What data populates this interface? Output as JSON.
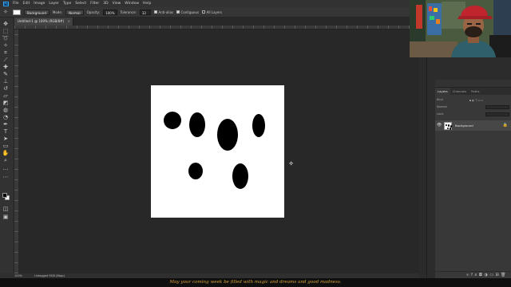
{
  "menubar": {
    "logo": "Ps",
    "items": [
      "File",
      "Edit",
      "Image",
      "Layer",
      "Type",
      "Select",
      "Filter",
      "3D",
      "View",
      "Window",
      "Help"
    ]
  },
  "optionsbar": {
    "sample_value": "Background",
    "mode_label": "Mode:",
    "mode_value": "Normal",
    "opacity_label": "Opacity:",
    "opacity_value": "100%",
    "tolerance_label": "Tolerance:",
    "tolerance_value": "32",
    "antialias_label": "Anti-alias",
    "antialias_checked": true,
    "contiguous_label": "Contiguous",
    "contiguous_checked": true,
    "alllayers_label": "All Layers",
    "alllayers_checked": false
  },
  "document": {
    "tab_title": "Untitled-1 @ 100% (RGB/8#)"
  },
  "statusbar": {
    "zoom": "100%",
    "info": "Untagged RGB (8bpc)"
  },
  "layers_panel": {
    "tabs": [
      "Layers",
      "Channels",
      "Paths"
    ],
    "active_tab": "Layers",
    "kind_label": "Kind",
    "blend_mode": "Normal",
    "lock_label": "Lock:",
    "layers": [
      {
        "name": "Background",
        "visible": true,
        "locked": true
      }
    ]
  },
  "subtitle": {
    "text": "May your coming week be filled with magic and dreams and good madness."
  },
  "colors": {
    "canvas_bg": "#282828",
    "document_bg": "#ffffff",
    "foreground": "#000000",
    "background": "#ffffff",
    "subtitle": "#d7a13a"
  },
  "icons": {
    "eye": "eye-icon",
    "lock": "lock-icon",
    "cursor": "crosshair-cursor-icon"
  }
}
